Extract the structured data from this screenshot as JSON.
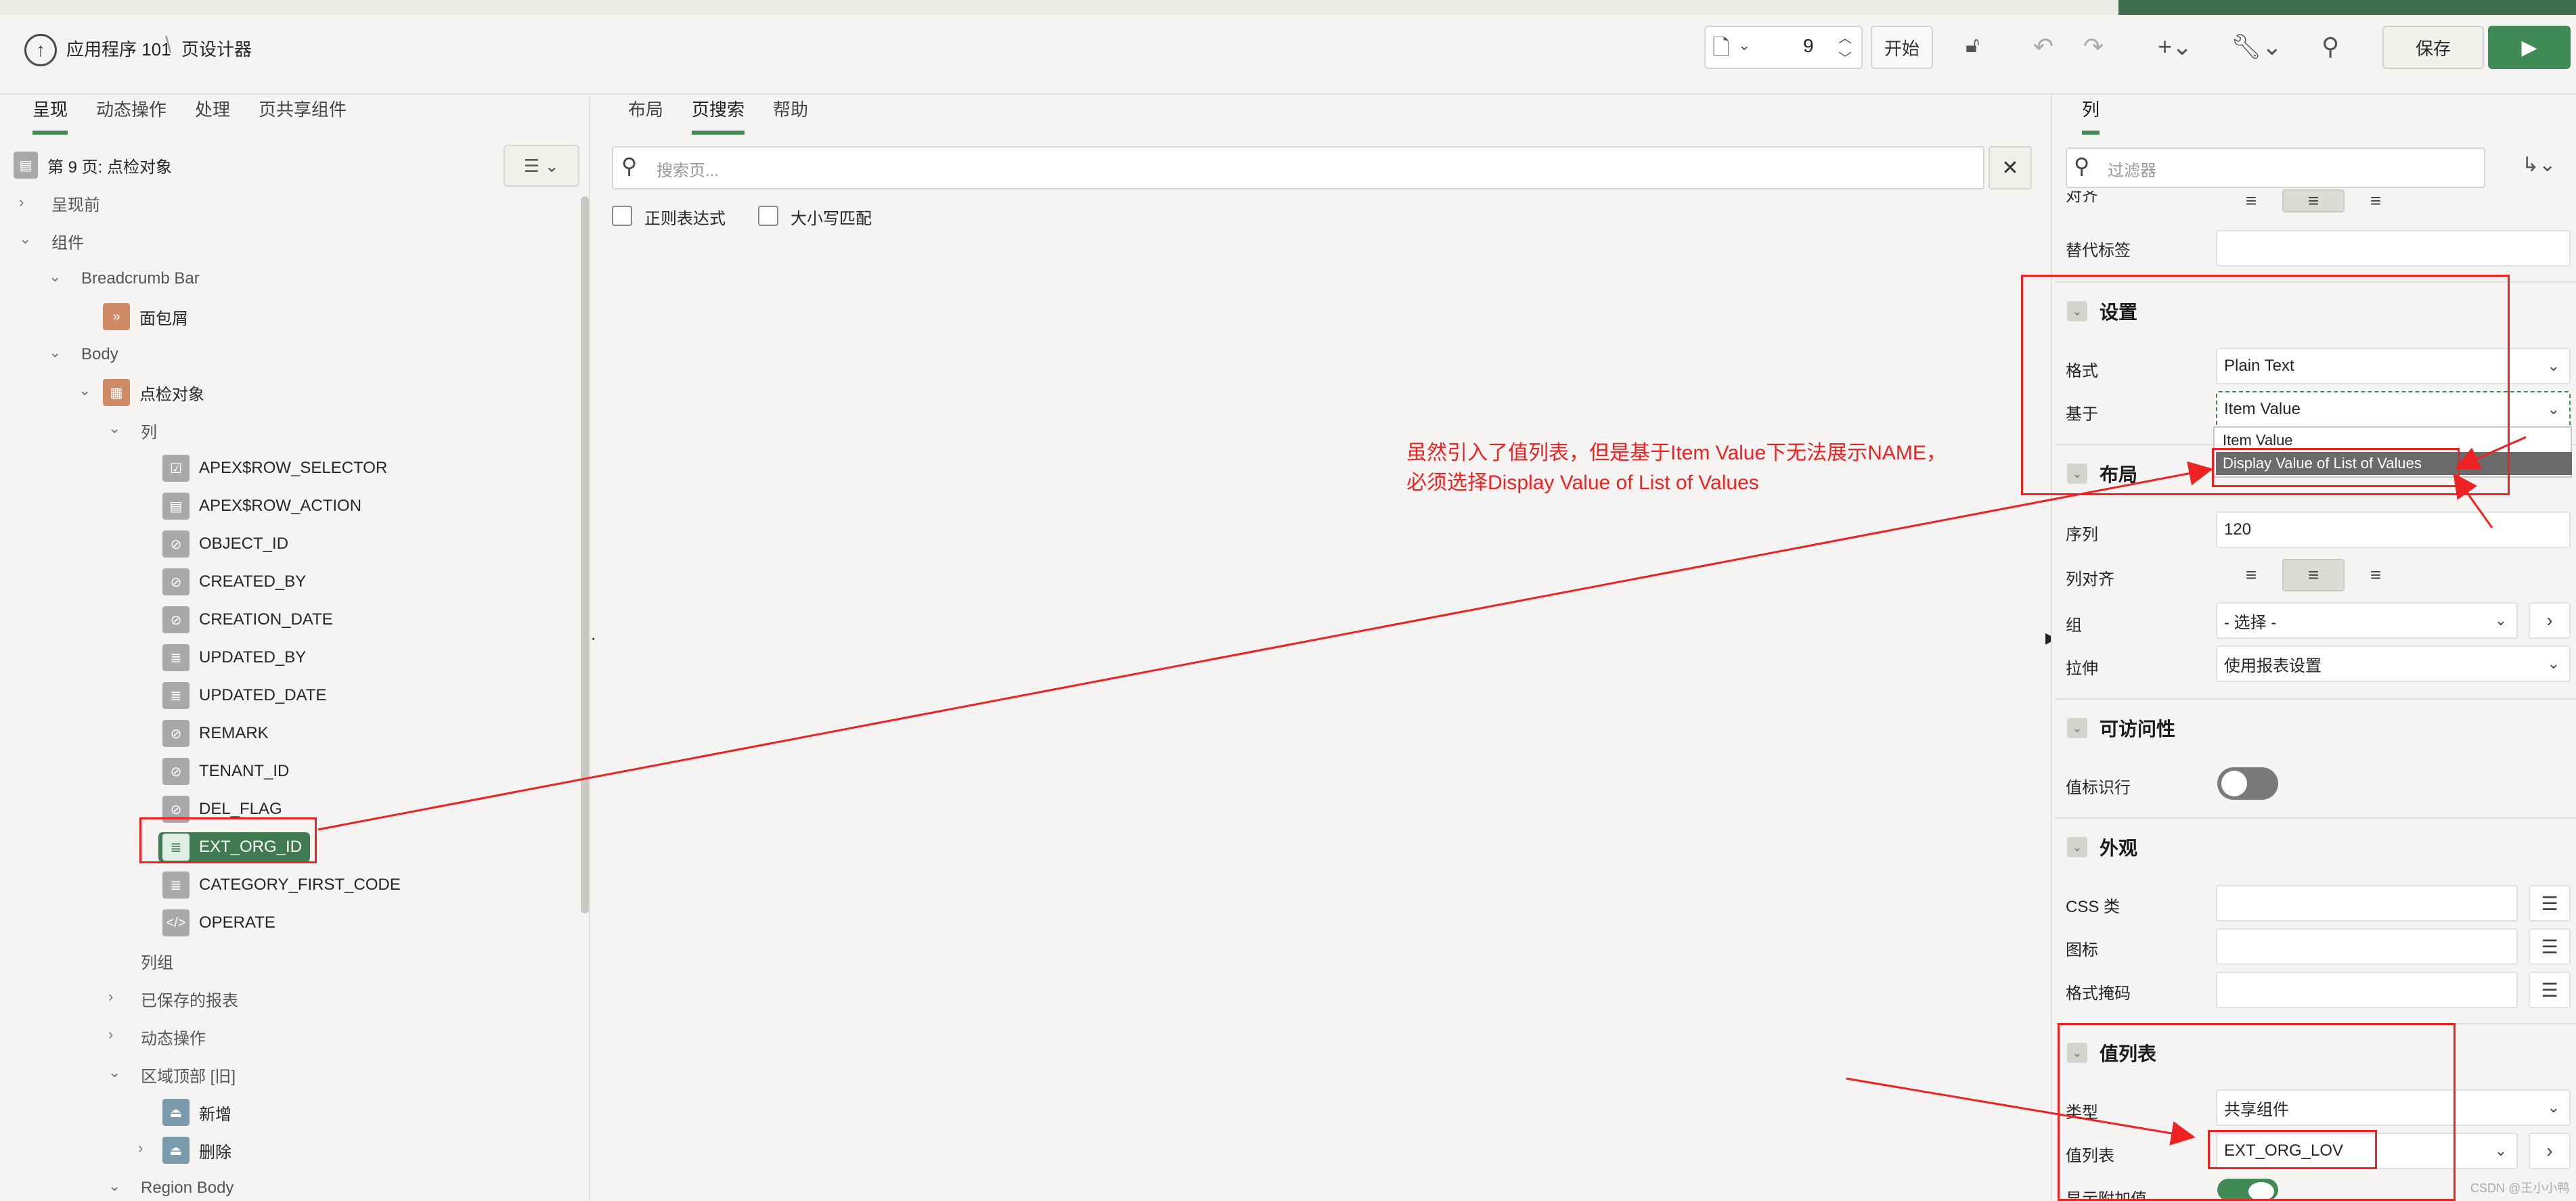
{
  "header": {
    "app_name": "应用程序 101",
    "page_name": "页设计器",
    "page_number": "9",
    "start_label": "开始",
    "save_label": "保存"
  },
  "left": {
    "tabs": [
      "呈现",
      "动态操作",
      "处理",
      "页共享组件"
    ],
    "page_title": "第 9 页: 点检对象",
    "tree": {
      "before_render": "呈现前",
      "components": "组件",
      "breadcrumb_bar": "Breadcrumb Bar",
      "breadcrumb": "面包屑",
      "body": "Body",
      "region": "点检对象",
      "columns": "列",
      "cols": [
        "APEX$ROW_SELECTOR",
        "APEX$ROW_ACTION",
        "OBJECT_ID",
        "CREATED_BY",
        "CREATION_DATE",
        "UPDATED_BY",
        "UPDATED_DATE",
        "REMARK",
        "TENANT_ID",
        "DEL_FLAG",
        "EXT_ORG_ID",
        "CATEGORY_FIRST_CODE",
        "OPERATE"
      ],
      "column_groups": "列组",
      "saved_reports": "已保存的报表",
      "dynamic_actions": "动态操作",
      "region_top": "区域顶部 [旧]",
      "new": "新增",
      "delete": "删除",
      "region_body": "Region Body"
    }
  },
  "middle": {
    "tabs": [
      "布局",
      "页搜索",
      "帮助"
    ],
    "search_placeholder": "搜索页...",
    "regex_label": "正则表达式",
    "case_label": "大小写匹配"
  },
  "right": {
    "tab": "列",
    "filter_placeholder": "过滤器",
    "truncated_label": "对齐",
    "alt_label": "替代标签",
    "settings": {
      "title": "设置",
      "format_label": "格式",
      "format_value": "Plain Text",
      "based_on_label": "基于",
      "based_on_value": "Item Value",
      "options": [
        "Item Value",
        "Display Value of List of Values"
      ]
    },
    "layout": {
      "title": "布局",
      "sequence_label": "序列",
      "sequence_value": "120",
      "col_align_label": "列对齐",
      "group_label": "组",
      "group_value": "- 选择 -",
      "stretch_label": "拉伸",
      "stretch_value": "使用报表设置"
    },
    "accessibility": {
      "title": "可访问性",
      "row_header_label": "值标识行"
    },
    "appearance": {
      "title": "外观",
      "css_label": "CSS 类",
      "icon_label": "图标",
      "format_mask_label": "格式掩码"
    },
    "lov": {
      "title": "值列表",
      "type_label": "类型",
      "type_value": "共享组件",
      "lov_label": "值列表",
      "lov_value": "EXT_ORG_LOV",
      "display_extra_label": "显示附加值"
    }
  },
  "annotation": {
    "line1": "虽然引入了值列表，但是基于Item Value下无法展示NAME，",
    "line2": "必须选择Display Value of List of Values"
  },
  "watermark": "CSDN @王小小鸭"
}
